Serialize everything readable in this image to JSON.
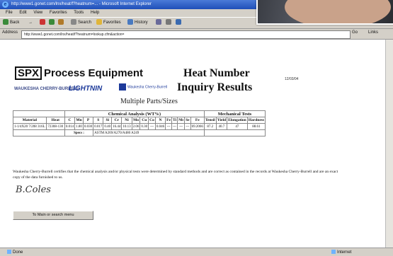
{
  "browser": {
    "title": "http://www1.gonet.com/lnx/heat/f?heatnum=...  - Microsoft Internet Explorer",
    "menu": [
      "File",
      "Edit",
      "View",
      "Favorites",
      "Tools",
      "Help"
    ],
    "toolbar": {
      "back": "Back",
      "forward": "→",
      "search": "Search",
      "favorites": "Favorites",
      "history": "History"
    },
    "address_label": "Address",
    "address_url": "http://www1.gonet.com/lnx/heat/f?heatnum=lookup.cfm&action=",
    "go_label": "Go",
    "links_label": "Links",
    "status_left": "Done",
    "status_right": "Internet"
  },
  "content": {
    "company": "Process Equipment",
    "company_mark": "SPX",
    "brands": [
      "WAUKESHA CHERRY-BURRELL",
      "LIGHTNIN",
      "Waukesha Cherry-Burrell"
    ],
    "heading_line1": "Heat Number",
    "heading_line2": "Inquiry Results",
    "date": "12/03/04",
    "subheading": "Multiple Parts/Sizes",
    "table": {
      "group_headers": {
        "chemical": "Chemical Analysis (WT%)",
        "mechanical": "Mechanical Tests"
      },
      "columns": [
        "Material",
        "Heat",
        "C",
        "Mn",
        "P",
        "S",
        "Si",
        "Cr",
        "Ni",
        "Mo",
        "Cu",
        "Co",
        "N",
        "Fe",
        "Ti",
        "Nb",
        "Se",
        "Fe",
        "Tensil",
        "Yield",
        "Elongation",
        "Hardness"
      ],
      "row": [
        "1-1/4X20 7/208 316L",
        "72308-130",
        "0.014",
        "1.80",
        "0.030",
        "0.017",
        "0.40",
        "16.44",
        "10.13",
        "2.06",
        "0.30",
        "---",
        "0.046",
        "---",
        "---",
        "---",
        "---",
        "69.2066",
        "87.2",
        "40.7",
        "47",
        "88.61"
      ],
      "spec_label": "Specs :",
      "spec_value": "ASTM A269/A270/A480 A249"
    },
    "certification": "Waukesha Cherry-Burrell certifies that the chemical analysis and/or physical tests were determined by standard methods and are correct as contained in the records at Waukesha Cherry-Burrell and are an exact copy of the data furnished to us.",
    "signature": "B.Coles",
    "menu_button": "To Main or search menu"
  }
}
